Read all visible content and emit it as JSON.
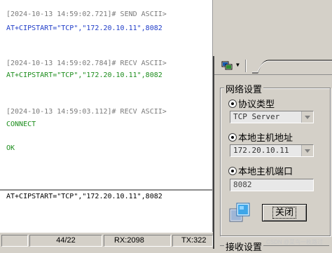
{
  "log": [
    {
      "kind": "meta",
      "text": "[2024-10-13 14:59:02.721]# SEND ASCII>"
    },
    {
      "kind": "send",
      "text": "AT+CIPSTART=\"TCP\",\"172.20.10.11\",8082"
    },
    {
      "kind": "meta",
      "text": "[2024-10-13 14:59:02.784]# RECV ASCII>"
    },
    {
      "kind": "recv",
      "text": "AT+CIPSTART=\"TCP\",\"172.20.10.11\",8082"
    },
    {
      "kind": "meta",
      "text": "[2024-10-13 14:59:03.112]# RECV ASCII>"
    },
    {
      "kind": "recv",
      "text": "CONNECT"
    },
    {
      "kind": "recv",
      "text": "OK"
    }
  ],
  "send_input": {
    "value": "AT+CIPSTART=\"TCP\",\"172.20.10.11\",8082"
  },
  "statusbar": {
    "cell0": "",
    "lines": "44/22",
    "rx": "RX:2098",
    "tx": "TX:322"
  },
  "settings": {
    "group_title": "网络设置",
    "protocol": {
      "label": "协议类型",
      "value": "TCP Server"
    },
    "local_ip": {
      "label": "本地主机地址",
      "value": "172.20.10.11"
    },
    "local_port": {
      "label": "本地主机端口",
      "value": "8082"
    },
    "close_label": "关闭",
    "recv_group_title": "接收设置"
  },
  "watermark": "CSDN @菜鸟一枚路过",
  "colors": {
    "send": "#1f3cc8",
    "recv": "#1c8d1c",
    "meta": "#7a7a7a"
  },
  "icons": {
    "toolbar": "network-monitor-icon",
    "status": "network-connection-icon"
  }
}
